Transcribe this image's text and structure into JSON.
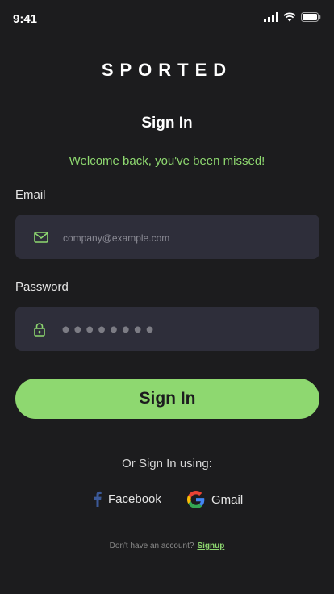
{
  "status": {
    "time": "9:41"
  },
  "brand": {
    "name": "SPORTED"
  },
  "title": "Sign In",
  "welcome": "Welcome back, you've been missed!",
  "email": {
    "label": "Email",
    "placeholder": "company@example.com",
    "icon": "mail-icon"
  },
  "password": {
    "label": "Password",
    "masked_value": "●●●●●●●●",
    "icon": "lock-icon"
  },
  "signin_button": "Sign In",
  "social": {
    "prompt": "Or Sign In using:",
    "facebook": "Facebook",
    "gmail": "Gmail"
  },
  "footer": {
    "text": "Don't have an account?",
    "link": "Signup"
  },
  "colors": {
    "accent": "#8ed870",
    "background": "#1c1c1e",
    "field": "#2e2e3a"
  }
}
